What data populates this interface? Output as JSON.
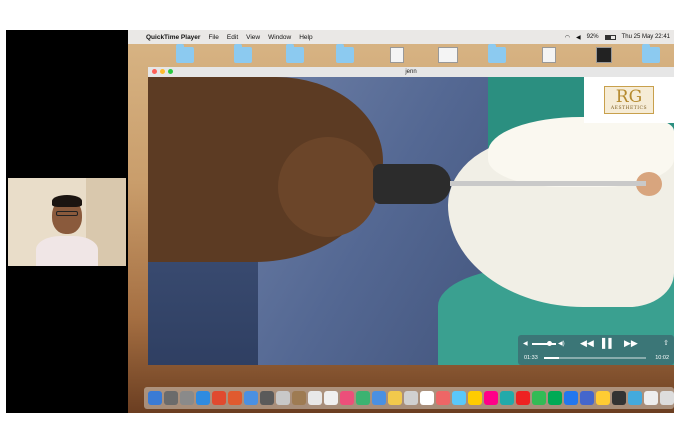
{
  "menubar": {
    "app_name": "QuickTime Player",
    "menus": [
      "File",
      "Edit",
      "View",
      "Window",
      "Help"
    ],
    "battery": "92%",
    "clock": "Thu 25 May  22:41"
  },
  "window": {
    "title": "jenn"
  },
  "logo": {
    "initials": "RG",
    "subtitle": "AESTHETICS"
  },
  "player": {
    "current_time": "01:33",
    "total_time": "10:02",
    "progress": 0.15,
    "volume": 0.7
  },
  "colors": {
    "menubar": "#ebebeb",
    "dock": "#d7cdc3",
    "controls": "#3c6e73",
    "logo_gold": "#b58a2e"
  },
  "icons": {
    "apple": "apple-icon",
    "rewind": "rewind-icon",
    "play": "play-pause-icon",
    "forward": "fast-forward-icon",
    "share": "share-icon",
    "volume": "volume-icon"
  },
  "dock": {
    "colors": [
      "#3a7bd5",
      "#6b6b6b",
      "#8a8a8a",
      "#2f8be0",
      "#e04a2f",
      "#e05a2f",
      "#4a90e2",
      "#5a5a5a",
      "#c8c8c8",
      "#9e7b52",
      "#e8e8e8",
      "#f0f0f0",
      "#ec4f7a",
      "#3cb371",
      "#4a90e2",
      "#f2c94c",
      "#d0d0d0",
      "#ffffff",
      "#e66",
      "#5ac8fa",
      "#ffcc00",
      "#f08",
      "#2aa",
      "#e22",
      "#3b5",
      "#0a5",
      "#27e",
      "#46c",
      "#fc3",
      "#333",
      "#4ad",
      "#eee",
      "#ddd",
      "#ccc",
      "#ddd",
      "#eee",
      "#ccc",
      "#bbb"
    ]
  }
}
